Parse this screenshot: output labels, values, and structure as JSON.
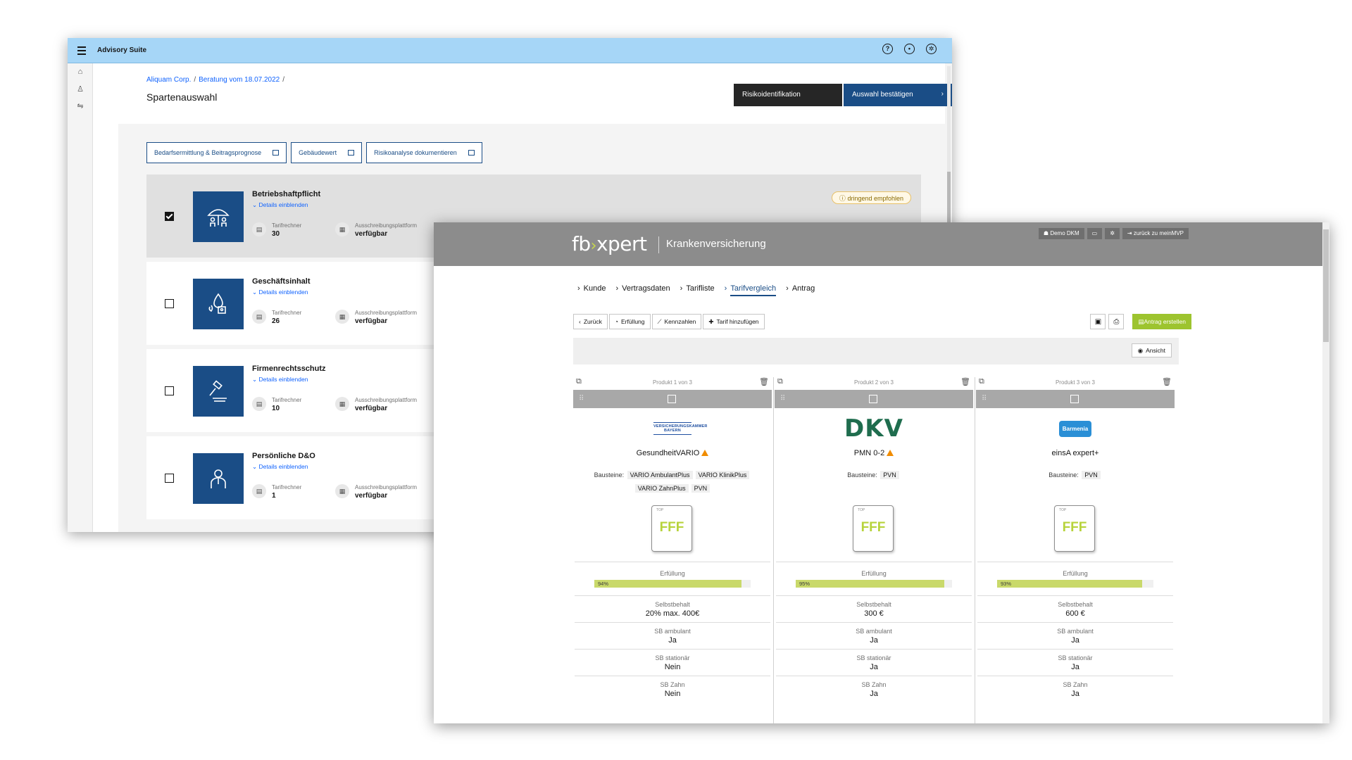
{
  "advisory": {
    "app_title": "Advisory Suite",
    "breadcrumb": [
      "Aliquam Corp.",
      "Beratung vom 18.07.2022"
    ],
    "page_title": "Spartenauswahl",
    "btn_risk": "Risikoidentifikation",
    "btn_confirm": "Auswahl bestätigen",
    "outline_buttons": [
      "Bedarfsermittlung & Beitragsprognose",
      "Gebäudewert",
      "Risikoanalyse dokumentieren"
    ],
    "details_label": "Details einblenden",
    "stat_label_1": "Tarifrechner",
    "stat_label_2": "Ausschreibungsplattform",
    "badge": "dringend empfohlen",
    "cards": [
      {
        "title": "Betriebshaftpflicht",
        "tarifrechner": "30",
        "plattform": "verfügbar",
        "selected": true,
        "icon": "umbrella-people-icon"
      },
      {
        "title": "Geschäftsinhalt",
        "tarifrechner": "26",
        "plattform": "verfügbar",
        "selected": false,
        "icon": "fire-water-icon"
      },
      {
        "title": "Firmenrechtsschutz",
        "tarifrechner": "10",
        "plattform": "verfügbar",
        "selected": false,
        "icon": "gavel-icon"
      },
      {
        "title": "Persönliche D&O",
        "tarifrechner": "1",
        "plattform": "verfügbar",
        "selected": false,
        "icon": "person-icon"
      }
    ]
  },
  "fbx": {
    "logo_left": "fb",
    "logo_right": "xpert",
    "product": "Krankenversicherung",
    "header_buttons": [
      "Demo DKM",
      "",
      "",
      "zurück zu meinMVP"
    ],
    "steps": [
      "Kunde",
      "Vertragsdaten",
      "Tarifliste",
      "Tarifvergleich",
      "Antrag"
    ],
    "active_step": "Tarifvergleich",
    "toolbar": [
      "Zurück",
      "Erfüllung",
      "Kennzahlen",
      "Tarif hinzufügen"
    ],
    "antrag_button": "Antrag erstellen",
    "ansicht_button": "Ansicht",
    "labels": {
      "bausteine": "Bausteine:",
      "erfuellung": "Erfüllung",
      "selbstbehalt": "Selbstbehalt",
      "sb_ambulant": "SB ambulant",
      "sb_stationaer": "SB stationär",
      "sb_zahn": "SB Zahn",
      "rating_top": "TOP",
      "rating": "FFF"
    },
    "products": [
      {
        "counter": "Produkt 1 von 3",
        "insurer_logo_text": "VERSICHERUNGSKAMMER BAYERN",
        "name": "GesundheitVARIO",
        "warning": true,
        "bausteine": [
          "VARIO AmbulantPlus",
          "VARIO KlinikPlus",
          "VARIO ZahnPlus",
          "PVN"
        ],
        "erfuellung_pct": 94,
        "erfuellung_label": "94%",
        "selbstbehalt": "20% max. 400€",
        "sb_ambulant": "Ja",
        "sb_stationaer": "Nein",
        "sb_zahn": "Nein"
      },
      {
        "counter": "Produkt 2 von 3",
        "insurer_logo_text": "DKV",
        "name": "PMN 0-2",
        "warning": true,
        "bausteine": [
          "PVN"
        ],
        "erfuellung_pct": 95,
        "erfuellung_label": "95%",
        "selbstbehalt": "300 €",
        "sb_ambulant": "Ja",
        "sb_stationaer": "Ja",
        "sb_zahn": "Ja"
      },
      {
        "counter": "Produkt 3 von 3",
        "insurer_logo_text": "Barmenia",
        "name": "einsA expert+",
        "warning": false,
        "bausteine": [
          "PVN"
        ],
        "erfuellung_pct": 93,
        "erfuellung_label": "93%",
        "selbstbehalt": "600 €",
        "sb_ambulant": "Ja",
        "sb_stationaer": "Ja",
        "sb_zahn": "Ja"
      }
    ],
    "colors": {
      "green": "#9dc42f",
      "dkv": "#1f6d4e",
      "barmenia": "#2a8fd6",
      "vkb": "#1f4fa0"
    }
  }
}
